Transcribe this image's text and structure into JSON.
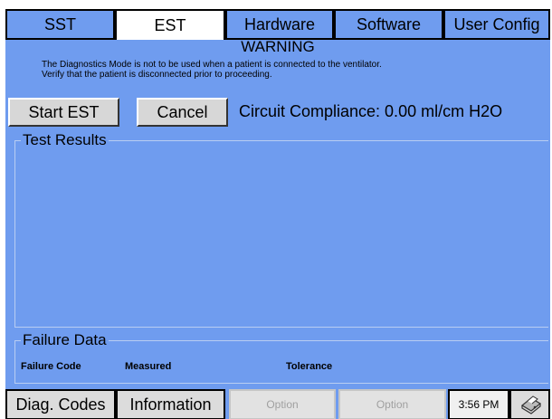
{
  "tabs": [
    {
      "label": "SST",
      "active": false
    },
    {
      "label": "EST",
      "active": true
    },
    {
      "label": "Hardware",
      "active": false
    },
    {
      "label": "Software",
      "active": false
    },
    {
      "label": "User Config",
      "active": false
    }
  ],
  "warning": {
    "title": "WARNING",
    "line1": "The Diagnostics Mode is not to be used when a patient is connected to the ventilator.",
    "line2": "Verify that the patient is disconnected prior to proceeding."
  },
  "actions": {
    "start_label": "Start EST",
    "cancel_label": "Cancel",
    "compliance": "Circuit Compliance: 0.00 ml/cm H2O"
  },
  "test_results": {
    "label": "Test Results"
  },
  "failure_data": {
    "label": "Failure Data",
    "columns": [
      "Failure Code",
      "Measured",
      "Tolerance"
    ]
  },
  "bottom_bar": {
    "diag_codes_label": "Diag. Codes",
    "information_label": "Information",
    "option1_label": "Option",
    "option2_label": "Option",
    "time": "3:56 PM",
    "right_icon": "printer-icon"
  },
  "colors": {
    "screen_bg": "#6f9cef",
    "active_tab_bg": "#ffffff",
    "button_bg": "#d7d7d7"
  }
}
